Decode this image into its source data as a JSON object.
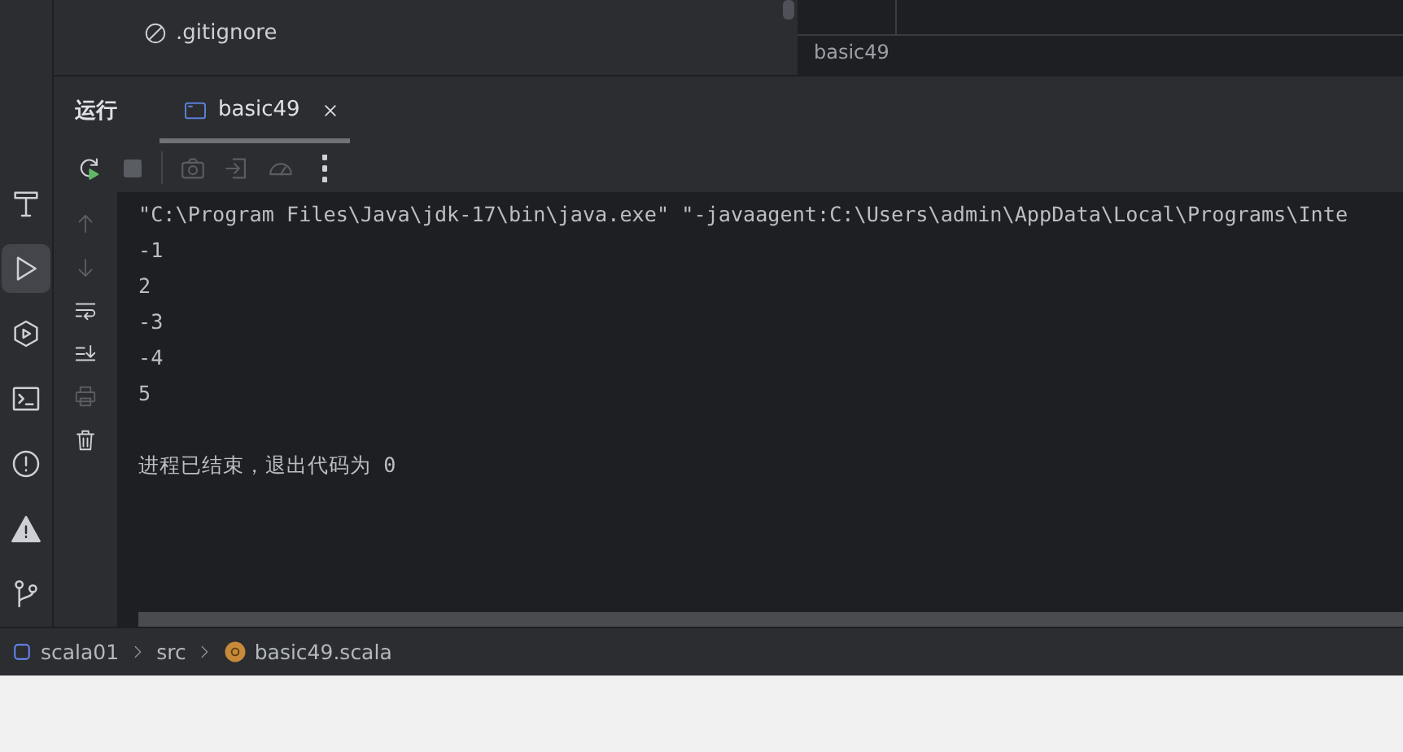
{
  "activity_bar": [
    {
      "kind": "build",
      "selected": false
    },
    {
      "kind": "run",
      "selected": true
    },
    {
      "kind": "services",
      "selected": false
    },
    {
      "kind": "terminal",
      "selected": false
    },
    {
      "kind": "problems",
      "selected": false
    },
    {
      "kind": "warning",
      "selected": false
    },
    {
      "kind": "git",
      "selected": false
    }
  ],
  "project_tree": {
    "items": [
      {
        "kind": "ignored",
        "label": ".gitignore"
      }
    ]
  },
  "editor": {
    "breadcrumb": "basic49"
  },
  "run_panel": {
    "title": "运行",
    "tabs": [
      {
        "label": "basic49",
        "selected": true
      }
    ],
    "toolbar": [
      {
        "kind": "rerun",
        "disabled": false
      },
      {
        "kind": "stop",
        "disabled": true
      },
      {
        "kind": "camera",
        "disabled": true
      },
      {
        "kind": "exit",
        "disabled": true
      },
      {
        "kind": "gauge",
        "disabled": true
      },
      {
        "kind": "more",
        "disabled": false
      }
    ],
    "gutter": [
      {
        "kind": "up",
        "disabled": true
      },
      {
        "kind": "down",
        "disabled": true
      },
      {
        "kind": "wrap",
        "disabled": false
      },
      {
        "kind": "scroll-end",
        "disabled": false
      },
      {
        "kind": "print",
        "disabled": true
      },
      {
        "kind": "trash",
        "disabled": false
      }
    ],
    "console": [
      {
        "kind": "command",
        "text": "\"C:\\Program Files\\Java\\jdk-17\\bin\\java.exe\" \"-javaagent:C:\\Users\\admin\\AppData\\Local\\Programs\\Inte"
      },
      {
        "kind": "output",
        "text": "-1"
      },
      {
        "kind": "output",
        "text": "2"
      },
      {
        "kind": "output",
        "text": "-3"
      },
      {
        "kind": "output",
        "text": "-4"
      },
      {
        "kind": "output",
        "text": "5"
      },
      {
        "kind": "exit",
        "text": "进程已结束，退出代码为 0"
      }
    ]
  },
  "status_bar": {
    "breadcrumb": [
      {
        "kind": "module",
        "label": "scala01"
      },
      {
        "kind": "folder",
        "label": "src"
      },
      {
        "kind": "file",
        "label": "basic49.scala"
      }
    ]
  }
}
